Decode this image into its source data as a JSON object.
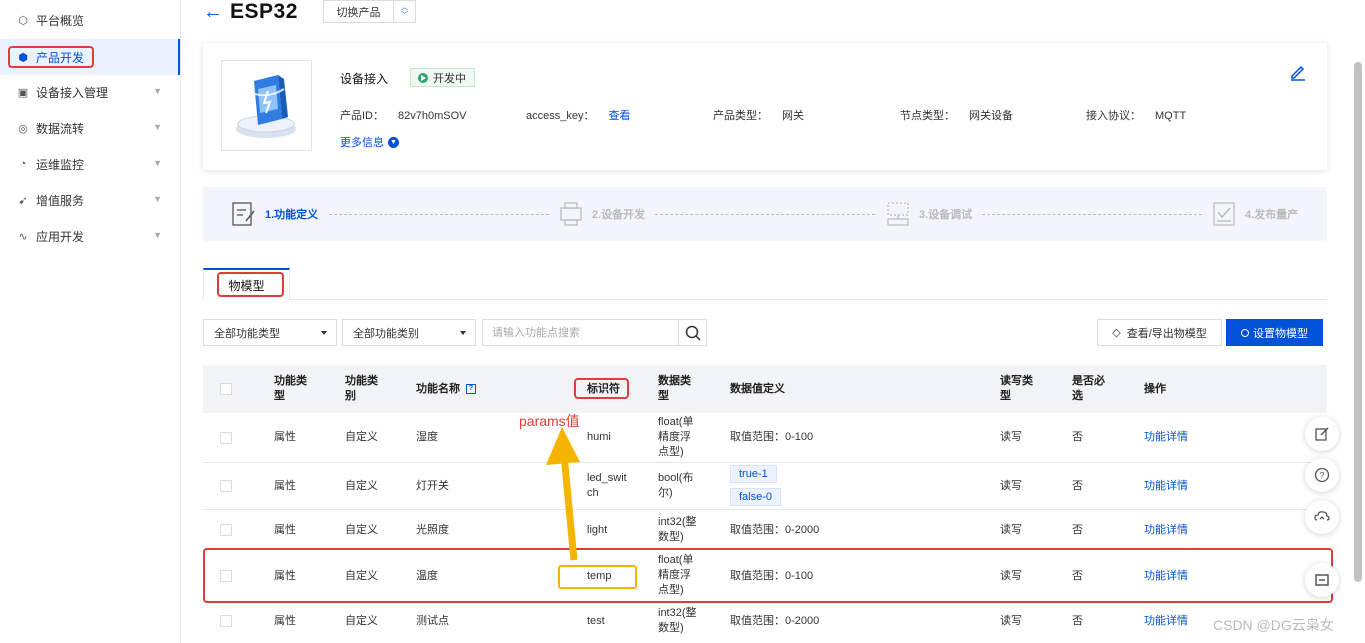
{
  "sidebar": {
    "items": [
      {
        "label": "平台概览",
        "icon": "platform-icon"
      },
      {
        "label": "产品开发",
        "icon": "cube-icon",
        "active": true
      },
      {
        "label": "设备接入管理",
        "icon": "device-icon",
        "chevron": true
      },
      {
        "label": "数据流转",
        "icon": "flow-icon",
        "chevron": true
      },
      {
        "label": "运维监控",
        "icon": "monitor-icon",
        "chevron": true
      },
      {
        "label": "增值服务",
        "icon": "service-icon",
        "chevron": true
      },
      {
        "label": "应用开发",
        "icon": "app-icon",
        "chevron": true
      }
    ]
  },
  "header": {
    "product_name": "ESP32",
    "switch_label": "切换产品"
  },
  "card": {
    "title": "设备接入",
    "status": "开发中",
    "fields": [
      {
        "key": "产品ID：",
        "value": "82v7h0mSOV"
      },
      {
        "key": "access_key：",
        "value": "查看"
      },
      {
        "key": "产品类型：",
        "value": "网关"
      },
      {
        "key": "节点类型：",
        "value": "网关设备"
      },
      {
        "key": "接入协议：",
        "value": "MQTT"
      }
    ],
    "more_info": "更多信息"
  },
  "steps": [
    {
      "label": "1.功能定义"
    },
    {
      "label": "2.设备开发"
    },
    {
      "label": "3.设备调试"
    },
    {
      "label": "4.发布量产"
    }
  ],
  "tab": {
    "label": "物模型"
  },
  "filters": {
    "type_select": "全部功能类型",
    "category_select": "全部功能类别",
    "search_placeholder": "请输入功能点搜索",
    "export_button": "查看/导出物模型",
    "setup_button": "设置物模型"
  },
  "table": {
    "headers": {
      "type": [
        "功能类",
        "型"
      ],
      "category": [
        "功能类",
        "别"
      ],
      "name": "功能名称",
      "identifier": "标识符",
      "datatype": [
        "数据类",
        "型"
      ],
      "definition": "数据值定义",
      "rw": [
        "读写类",
        "型"
      ],
      "required": [
        "是否必",
        "选"
      ],
      "action": "操作"
    },
    "rows": [
      {
        "type": "属性",
        "category": "自定义",
        "name": "湿度",
        "identifier": [
          "humi"
        ],
        "datatype": [
          "float(单",
          "精度浮",
          "点型)"
        ],
        "definition": "取值范围：0-100",
        "rw": "读写",
        "required": "否",
        "action": "功能详情"
      },
      {
        "type": "属性",
        "category": "自定义",
        "name": "灯开关",
        "identifier": [
          "led_swit",
          "ch"
        ],
        "datatype": [
          "bool(布",
          "尔)"
        ],
        "enum": [
          "true-1",
          "false-0"
        ],
        "rw": "读写",
        "required": "否",
        "action": "功能详情"
      },
      {
        "type": "属性",
        "category": "自定义",
        "name": "光照度",
        "identifier": [
          "light"
        ],
        "datatype": [
          "int32(整",
          "数型)"
        ],
        "definition": "取值范围：0-2000",
        "rw": "读写",
        "required": "否",
        "action": "功能详情"
      },
      {
        "type": "属性",
        "category": "自定义",
        "name": "温度",
        "identifier": [
          "temp"
        ],
        "datatype": [
          "float(单",
          "精度浮",
          "点型)"
        ],
        "definition": "取值范围：0-100",
        "rw": "读写",
        "required": "否",
        "action": "功能详情"
      },
      {
        "type": "属性",
        "category": "自定义",
        "name": "测试点",
        "identifier": [
          "test"
        ],
        "datatype": [
          "int32(整",
          "数型)"
        ],
        "definition": "取值范围：0-2000",
        "rw": "读写",
        "required": "否",
        "action": "功能详情"
      }
    ]
  },
  "annotation": {
    "text": "params值"
  },
  "watermark": "CSDN @DG云枭女",
  "colors": {
    "primary": "#0052d9",
    "annotation_red": "#e03c3c",
    "annotation_yellow": "#f5b400",
    "status_green": "#2ba471"
  }
}
